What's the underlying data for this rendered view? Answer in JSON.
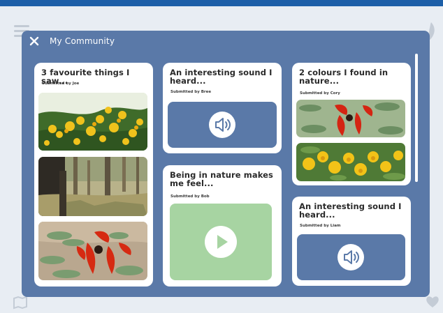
{
  "modal": {
    "title": "My Community",
    "close_icon": "close-icon"
  },
  "posts": [
    {
      "title": "3 favourite things I saw...",
      "submitted": "Submitted by Joe",
      "media": "photos",
      "photos": [
        "yellow-flowers-photo",
        "forest-photo",
        "red-flower-photo"
      ]
    },
    {
      "title": "An interesting sound I heard...",
      "submitted": "Submitted by Bree",
      "media": "audio",
      "icon": "speaker-icon"
    },
    {
      "title": "2 colours I found in nature...",
      "submitted": "Submitted by Cory",
      "media": "photos",
      "photos": [
        "red-flower-photo",
        "yellow-flowers-photo"
      ]
    },
    {
      "title": "Being in nature makes me feel...",
      "submitted": "Submitted by Bob",
      "media": "video",
      "icon": "play-icon"
    },
    {
      "title": "An interesting sound I heard...",
      "submitted": "Submitted by Liam",
      "media": "audio",
      "icon": "speaker-icon"
    }
  ],
  "colors": {
    "top_bar": "#1d5fa8",
    "modal_bg": "#5a79a8",
    "audio_bg": "#5a79a8",
    "video_bg": "#a7d4a2",
    "card_bg": "#ffffff"
  }
}
